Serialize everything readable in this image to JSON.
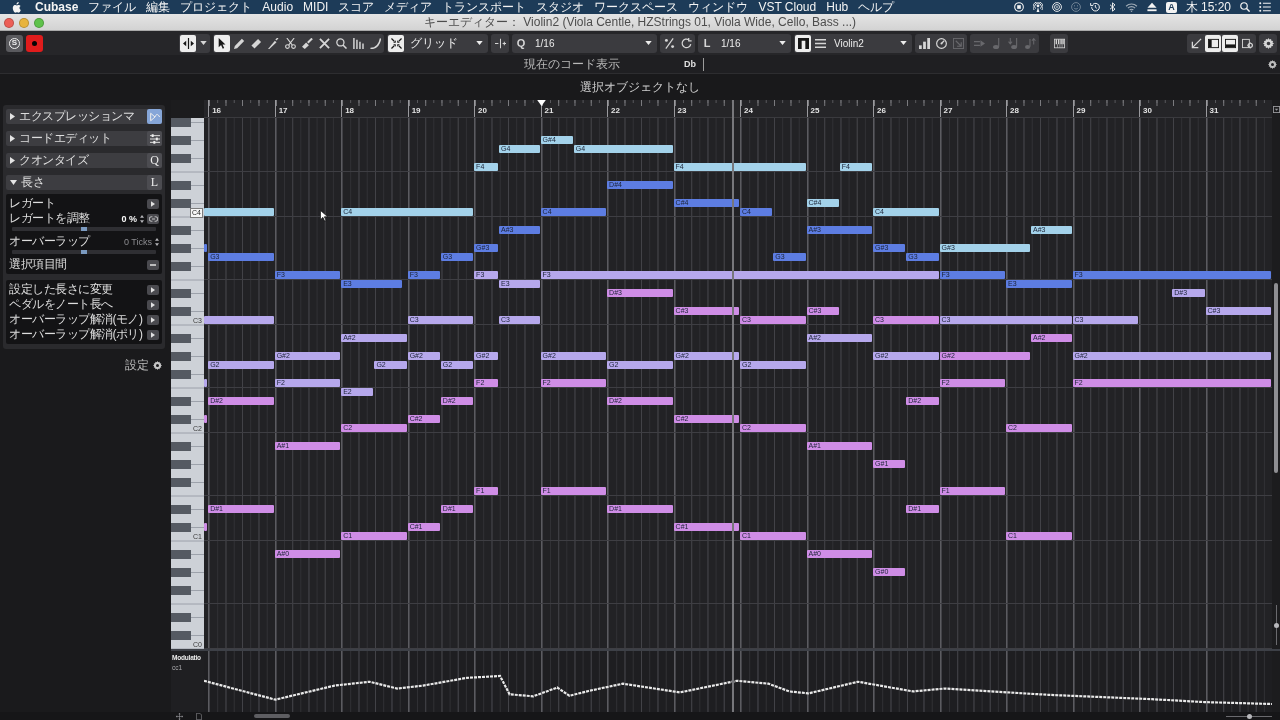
{
  "menubar": {
    "items": [
      "Cubase",
      "ファイル",
      "編集",
      "プロジェクト",
      "Audio",
      "MIDI",
      "スコア",
      "メディア",
      "トランスポート",
      "スタジオ",
      "ワークスペース",
      "ウィンドウ",
      "VST Cloud",
      "Hub",
      "ヘルプ"
    ],
    "input_source": "A",
    "clock": "木 15:20"
  },
  "window": {
    "title": "キーエディター： Violin2 (Viola Centle, HZStrings 01, Viola Wide, Cello, Bass ...)"
  },
  "toolbar": {
    "solo": {
      "glyph": "S",
      "on": false
    },
    "record": {
      "on": true
    },
    "tool_mode": {
      "on": true
    },
    "tools": [
      {
        "selected": true
      },
      {
        "selected": false
      },
      {
        "selected": false
      },
      {
        "selected": false
      },
      {
        "selected": false
      },
      {
        "selected": false
      },
      {
        "selected": false
      },
      {
        "selected": false
      },
      {
        "selected": false
      },
      {
        "selected": false
      }
    ],
    "snap": {
      "on": true,
      "mode": "グリッド"
    },
    "quantize": {
      "glyph": "Q",
      "value": "1/16"
    },
    "length": {
      "glyph": "L",
      "value": "1/16"
    },
    "track": {
      "on": true,
      "name": "Violin2"
    },
    "edit_buttons": [
      {
        "disabled": false
      },
      {
        "disabled": false
      },
      {
        "disabled": true
      }
    ],
    "step_buttons": [
      {
        "disabled": true
      },
      {
        "disabled": true
      },
      {
        "disabled": true
      },
      {
        "disabled": true
      }
    ],
    "layout_buttons": [
      {
        "on": false
      },
      {
        "on": true
      },
      {
        "on": true
      },
      {
        "on": false
      }
    ]
  },
  "chord_display": {
    "label": "現在のコード表示",
    "chord": "Db"
  },
  "selection_info": "選択オブジェクトなし",
  "inspector": {
    "sections": [
      {
        "title": "エクスプレッションマ",
        "expanded": false,
        "icon_on": true
      },
      {
        "title": "コードエディット",
        "expanded": false,
        "icon_on": false
      },
      {
        "title": "クオンタイズ",
        "expanded": false,
        "icon_on": false,
        "glyph": "Q"
      },
      {
        "title": "長さ",
        "expanded": true,
        "icon_on": false,
        "glyph": "L",
        "options": [
          {
            "kind": "action",
            "label": "レガート"
          },
          {
            "kind": "adjust",
            "label": "レガートを調整",
            "value": "0 %",
            "disabled": false
          },
          {
            "kind": "slider",
            "level": 0.5
          },
          {
            "kind": "stepper",
            "label": "オーバーラップ",
            "value": "0 Ticks",
            "disabled": true
          },
          {
            "kind": "slider",
            "level": 0.5
          },
          {
            "kind": "option",
            "label": "選択項目間"
          }
        ],
        "actions": [
          "設定した長さに変更",
          "ペダルをノート長へ",
          "オーバーラップ解消(モノ)",
          "オーバーラップ解消(ポリ)"
        ]
      }
    ],
    "settings_label": "設定"
  },
  "editor": {
    "ruler": {
      "bars": [
        "16",
        "17",
        "18",
        "19",
        "20",
        "21",
        "22",
        "23",
        "24",
        "25",
        "26",
        "27",
        "28",
        "29",
        "30",
        "31"
      ]
    },
    "keyboard": {
      "labels": [
        {
          "text": "C4",
          "highlighted": true
        },
        {
          "text": "C3",
          "highlighted": false
        },
        {
          "text": "C2",
          "highlighted": false
        },
        {
          "text": "C1",
          "highlighted": false
        },
        {
          "text": "C0",
          "highlighted": false
        }
      ]
    },
    "notes": [
      {
        "label": "G#4",
        "color": "#a3d2ea"
      },
      {
        "label": "G4",
        "color": "#a3d2ea"
      },
      {
        "label": "G4",
        "color": "#a3d2ea"
      },
      {
        "label": "F4",
        "color": "#a3d2ea"
      },
      {
        "label": "F4",
        "color": "#a3d2ea"
      },
      {
        "label": "F4",
        "color": "#a3d2ea"
      },
      {
        "label": "D#4",
        "color": "#5d7de2"
      },
      {
        "label": "C#4",
        "color": "#5d7de2"
      },
      {
        "label": "C#4",
        "color": "#a3d2ea"
      },
      {
        "color": "#a3d2ea"
      },
      {
        "label": "C4",
        "color": "#a3d2ea"
      },
      {
        "label": "C4",
        "color": "#5d7de2"
      },
      {
        "label": "C4",
        "color": "#5d7de2"
      },
      {
        "label": "C4",
        "color": "#a3d2ea"
      },
      {
        "label": "A#3",
        "color": "#5d7de2"
      },
      {
        "label": "A#3",
        "color": "#5d7de2"
      },
      {
        "label": "A#3",
        "color": "#a3d2ea"
      },
      {
        "color": "#5d7de2"
      },
      {
        "label": "G#3",
        "color": "#5d7de2"
      },
      {
        "label": "G#3",
        "color": "#5d7de2"
      },
      {
        "label": "G#3",
        "color": "#a3d2ea"
      },
      {
        "label": "G3",
        "color": "#5d7de2"
      },
      {
        "label": "G3",
        "color": "#5d7de2"
      },
      {
        "label": "G3",
        "color": "#5d7de2"
      },
      {
        "label": "G3",
        "color": "#5d7de2"
      },
      {
        "label": "F3",
        "color": "#5d7de2"
      },
      {
        "label": "F3",
        "color": "#5d7de2"
      },
      {
        "label": "F3",
        "color": "#b6a8ec"
      },
      {
        "label": "F3",
        "color": "#b6a8ec"
      },
      {
        "label": "F3",
        "color": "#5d7de2"
      },
      {
        "label": "F3",
        "color": "#5d7de2"
      },
      {
        "label": "E3",
        "color": "#5d7de2"
      },
      {
        "label": "E3",
        "color": "#b6a8ec"
      },
      {
        "label": "E3",
        "color": "#5d7de2"
      },
      {
        "label": "D#3",
        "color": "#cf8de6"
      },
      {
        "label": "D#3",
        "color": "#b6a8ec"
      },
      {
        "label": "C#3",
        "color": "#cf8de6"
      },
      {
        "label": "C#3",
        "color": "#cf8de6"
      },
      {
        "label": "C#3",
        "color": "#b6a8ec"
      },
      {
        "color": "#b6a8ec"
      },
      {
        "label": "C3",
        "color": "#b6a8ec"
      },
      {
        "label": "C3",
        "color": "#b6a8ec"
      },
      {
        "label": "C3",
        "color": "#cf8de6"
      },
      {
        "label": "C3",
        "color": "#cf8de6"
      },
      {
        "label": "C3",
        "color": "#b6a8ec"
      },
      {
        "label": "C3",
        "color": "#b6a8ec"
      },
      {
        "label": "A#2",
        "color": "#b6a8ec"
      },
      {
        "label": "A#2",
        "color": "#b6a8ec"
      },
      {
        "label": "A#2",
        "color": "#cf8de6"
      },
      {
        "label": "G#2",
        "color": "#b6a8ec"
      },
      {
        "label": "G#2",
        "color": "#b6a8ec"
      },
      {
        "label": "G#2",
        "color": "#b6a8ec"
      },
      {
        "label": "G#2",
        "color": "#b6a8ec"
      },
      {
        "label": "G#2",
        "color": "#b6a8ec"
      },
      {
        "label": "G#2",
        "color": "#b6a8ec"
      },
      {
        "label": "G#2",
        "color": "#cf8de6"
      },
      {
        "label": "G#2",
        "color": "#b6a8ec"
      },
      {
        "label": "G2",
        "color": "#b6a8ec"
      },
      {
        "label": "G2",
        "color": "#b6a8ec"
      },
      {
        "label": "G2",
        "color": "#b6a8ec"
      },
      {
        "label": "G2",
        "color": "#b6a8ec"
      },
      {
        "label": "G2",
        "color": "#b6a8ec"
      },
      {
        "color": "#b6a8ec"
      },
      {
        "label": "F2",
        "color": "#b6a8ec"
      },
      {
        "label": "F2",
        "color": "#cf8de6"
      },
      {
        "label": "F2",
        "color": "#cf8de6"
      },
      {
        "label": "F2",
        "color": "#cf8de6"
      },
      {
        "label": "F2",
        "color": "#cf8de6"
      },
      {
        "label": "E2",
        "color": "#b6a8ec"
      },
      {
        "label": "D#2",
        "color": "#cf8de6"
      },
      {
        "label": "D#2",
        "color": "#cf8de6"
      },
      {
        "label": "D#2",
        "color": "#cf8de6"
      },
      {
        "label": "D#2",
        "color": "#cf8de6"
      },
      {
        "color": "#cf8de6"
      },
      {
        "label": "C#2",
        "color": "#cf8de6"
      },
      {
        "label": "C#2",
        "color": "#cf8de6"
      },
      {
        "label": "C2",
        "color": "#cf8de6"
      },
      {
        "label": "C2",
        "color": "#cf8de6"
      },
      {
        "label": "C2",
        "color": "#cf8de6"
      },
      {
        "label": "A#1",
        "color": "#cf8de6"
      },
      {
        "label": "A#1",
        "color": "#cf8de6"
      },
      {
        "label": "G#1",
        "color": "#cf8de6"
      },
      {
        "label": "F1",
        "color": "#cf8de6"
      },
      {
        "label": "F1",
        "color": "#cf8de6"
      },
      {
        "label": "F1",
        "color": "#cf8de6"
      },
      {
        "label": "D#1",
        "color": "#cf8de6"
      },
      {
        "label": "D#1",
        "color": "#cf8de6"
      },
      {
        "label": "D#1",
        "color": "#cf8de6"
      },
      {
        "label": "D#1",
        "color": "#cf8de6"
      },
      {
        "color": "#cf8de6"
      },
      {
        "label": "C#1",
        "color": "#cf8de6"
      },
      {
        "label": "C#1",
        "color": "#cf8de6"
      },
      {
        "label": "C1",
        "color": "#cf8de6"
      },
      {
        "label": "C1",
        "color": "#cf8de6"
      },
      {
        "label": "C1",
        "color": "#cf8de6"
      },
      {
        "label": "A#0",
        "color": "#cf8de6"
      },
      {
        "label": "A#0",
        "color": "#cf8de6"
      },
      {
        "label": "G#0",
        "color": "#cf8de6"
      }
    ],
    "controller_lane": {
      "name": "Modulatio",
      "cc": "cc1"
    },
    "vertical_zoom_slider": {
      "level": 0.5
    },
    "zoom_slider": {
      "level": 0.5
    }
  }
}
